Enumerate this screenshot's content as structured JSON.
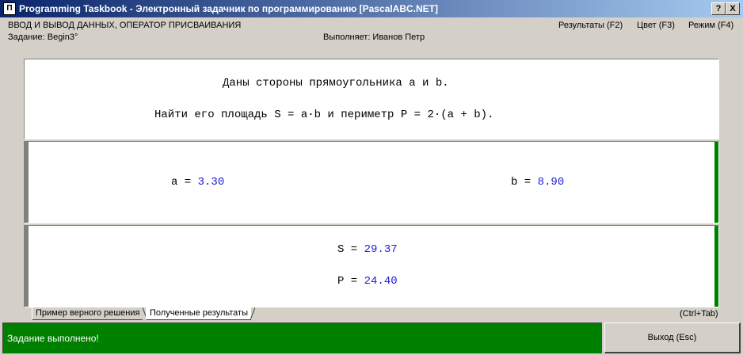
{
  "window": {
    "title": "Programming Taskbook - Электронный задачник по программированию [PascalABC.NET]",
    "icon_label": "Π",
    "help_button": "?",
    "close_button": "X"
  },
  "header": {
    "section": "ВВОД И ВЫВОД ДАННЫХ, ОПЕРАТОР ПРИСВАИВАНИЯ",
    "task": "Задание: Begin3°",
    "performer": "Выполняет: Иванов Петр",
    "menu": {
      "results": "Результаты (F2)",
      "color": "Цвет (F3)",
      "mode": "Режим (F4)"
    }
  },
  "task_text": {
    "line1": "Даны стороны прямоугольника a и b.",
    "line2": "Найти его площадь S = a·b и периметр P = 2·(a + b)."
  },
  "input_data": {
    "a_label": "a = ",
    "a_value": "3.30",
    "b_label": "b = ",
    "b_value": "8.90"
  },
  "results": {
    "s_label": "S = ",
    "s_value": "29.37",
    "p_label": "P = ",
    "p_value": "24.40"
  },
  "tabs": {
    "sample": "Пример верного решения",
    "obtained": "Полученные результаты",
    "shortcut": "(Ctrl+Tab)"
  },
  "status": {
    "message": "Задание выполнено!",
    "exit_button": "Выход (Esc)"
  },
  "colors": {
    "success": "#008000",
    "value": "#2020d8",
    "title_bar": "#0a246a"
  }
}
